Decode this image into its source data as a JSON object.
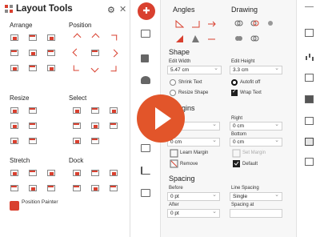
{
  "left_panel": {
    "title": "Layout Tools",
    "sections": {
      "arrange": "Arrange",
      "position": "Position",
      "resize": "Resize",
      "select": "Select",
      "stretch": "Stretch",
      "dock": "Dock"
    },
    "position_painter": "Position Painter"
  },
  "main": {
    "angles": "Angles",
    "drawing": "Drawing",
    "shape": "Shape",
    "edit_width_label": "Edit Width",
    "edit_width_value": "5.47 cm",
    "edit_height_label": "Edit Height",
    "edit_height_value": "3.3 cm",
    "shrink_text": "Shrink Text",
    "autofit_off": "Autofit off",
    "resize_shape": "Resize Shape",
    "wrap_text": "Wrap Text",
    "margins": "gins",
    "right_label": "Right",
    "right_value": "0 cm",
    "bottom_label": "Bottom",
    "bottom_value": "0 cm",
    "left_value": "0 cm",
    "learn_margin": "Learn Margin",
    "set_margin": "Set Margin",
    "remove": "Remove",
    "default": "Default",
    "spacing": "Spacing",
    "before_label": "Before",
    "before_value": "0 pt",
    "after_label": "After",
    "after_value": "0 pt",
    "line_spacing_label": "Line Spacing",
    "line_spacing_value": "Single",
    "spacing_at_label": "Spacing at"
  },
  "colors": {
    "accent": "#d9402f",
    "play": "#e2552a"
  }
}
